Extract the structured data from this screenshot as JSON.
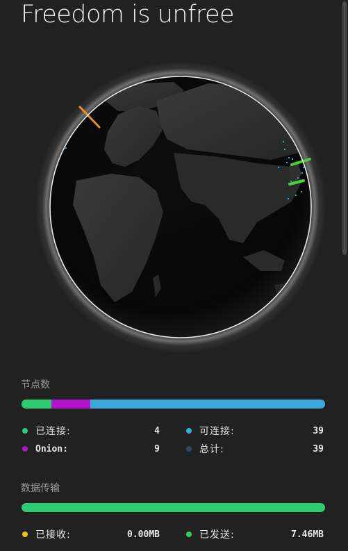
{
  "header": {
    "title": "Freedom is unfree"
  },
  "globe": {
    "connection_colors": [
      "#e8921e",
      "#4ccf33",
      "#45d63a"
    ],
    "node_color": "#3aa0e0"
  },
  "nodes": {
    "section_label": "节点数",
    "bar": [
      {
        "name": "connected",
        "value": 4,
        "color": "#2ecc71"
      },
      {
        "name": "onion",
        "value": 9,
        "color": "#b313cc"
      },
      {
        "name": "reachable",
        "value": 39,
        "color": "#3aa8d8"
      }
    ],
    "connected_label": "已连接:",
    "connected_value": "4",
    "connected_color": "#2ecc71",
    "reachable_label": "可连接:",
    "reachable_value": "39",
    "reachable_color": "#3aa8d8",
    "onion_label": "Onion:",
    "onion_value": "9",
    "onion_color": "#b313cc",
    "total_label": "总计:",
    "total_value": "39",
    "total_color": "#34495e"
  },
  "transfer": {
    "section_label": "数据传输",
    "bar": [
      {
        "name": "received",
        "value": 0.0,
        "color": "#f1c40f"
      },
      {
        "name": "sent",
        "value": 7.46,
        "color": "#2ecc71"
      }
    ],
    "received_label": "已接收:",
    "received_value": "0.00MB",
    "received_color": "#f1c40f",
    "sent_label": "已发送:",
    "sent_value": "7.46MB",
    "sent_color": "#2ecc71"
  }
}
